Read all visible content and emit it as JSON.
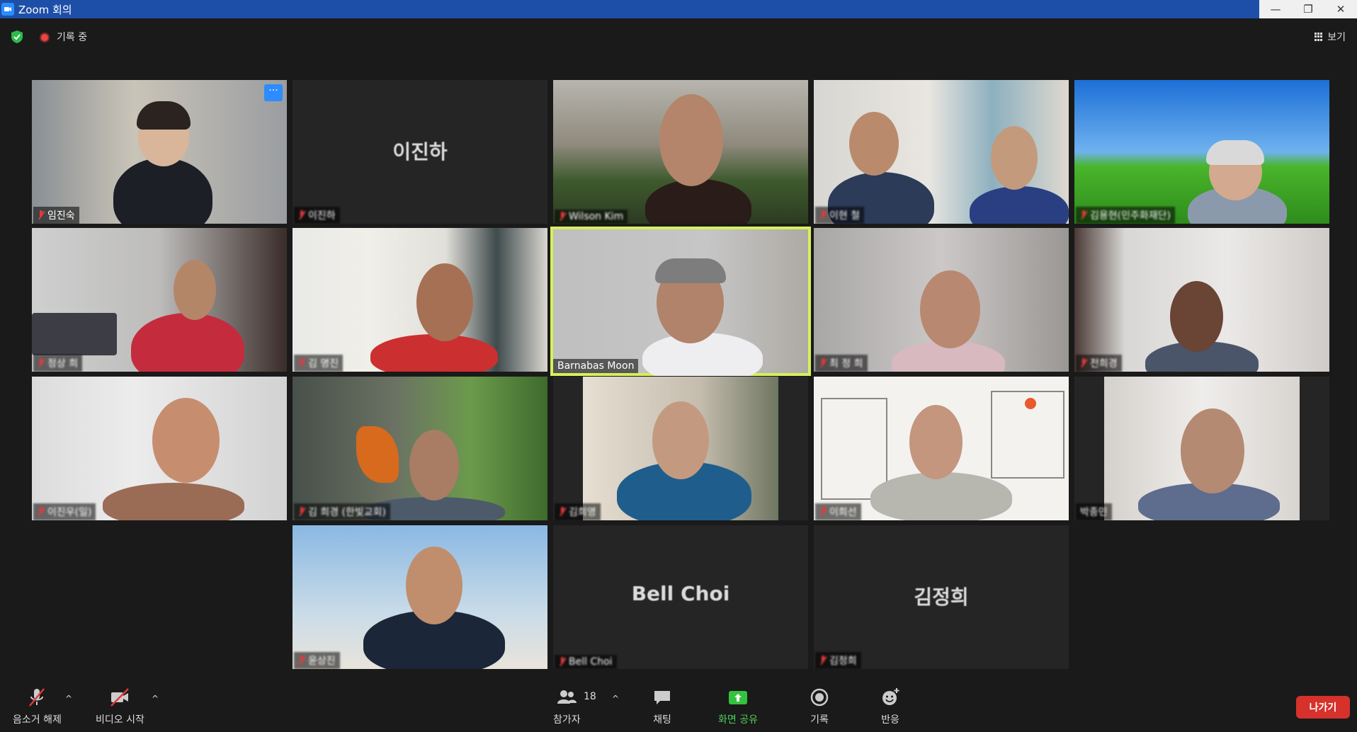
{
  "window": {
    "title": "Zoom 회의"
  },
  "topbar": {
    "recording_label": "기록 중",
    "view_label": "보기"
  },
  "participants": [
    {
      "name": "임진숙",
      "display": "",
      "muted": true,
      "has_video": true,
      "more": "···"
    },
    {
      "name": "이진하",
      "display": "이진하",
      "muted": true,
      "has_video": false
    },
    {
      "name": "Wilson Kim",
      "display": "",
      "muted": true,
      "has_video": true
    },
    {
      "name": "이현 철",
      "display": "",
      "muted": true,
      "has_video": true
    },
    {
      "name": "김용현(민주화재단)",
      "display": "",
      "muted": true,
      "has_video": true
    },
    {
      "name": "정상 희",
      "display": "",
      "muted": true,
      "has_video": true
    },
    {
      "name": "김 명진",
      "display": "",
      "muted": true,
      "has_video": true
    },
    {
      "name": "Barnabas Moon",
      "display": "",
      "muted": false,
      "has_video": true,
      "active": true
    },
    {
      "name": "최 정 희",
      "display": "",
      "muted": true,
      "has_video": true
    },
    {
      "name": "전희경",
      "display": "",
      "muted": true,
      "has_video": true
    },
    {
      "name": "이진우(일)",
      "display": "",
      "muted": true,
      "has_video": true
    },
    {
      "name": "김 희경 (한빛교회)",
      "display": "",
      "muted": true,
      "has_video": true
    },
    {
      "name": "김희영",
      "display": "",
      "muted": true,
      "has_video": true
    },
    {
      "name": "이희선",
      "display": "",
      "muted": true,
      "has_video": true
    },
    {
      "name": "박종민",
      "display": "",
      "muted": false,
      "has_video": true
    },
    {
      "name": "윤상진",
      "display": "",
      "muted": true,
      "has_video": true
    },
    {
      "name": "Bell Choi",
      "display": "Bell Choi",
      "muted": true,
      "has_video": false
    },
    {
      "name": "김정희",
      "display": "김정희",
      "muted": true,
      "has_video": false
    }
  ],
  "toolbar": {
    "unmute_label": "음소거 해제",
    "start_video_label": "비디오 시작",
    "participants_label": "참가자",
    "participants_count": "18",
    "chat_label": "채팅",
    "share_label": "화면 공유",
    "record_label": "기록",
    "reactions_label": "반응",
    "leave_label": "나가기",
    "caret": "^"
  },
  "colors": {
    "active_speaker": "#d6f05a",
    "share_green": "#4fd05a",
    "leave_red": "#d6312b",
    "accent": "#2d8cff"
  }
}
